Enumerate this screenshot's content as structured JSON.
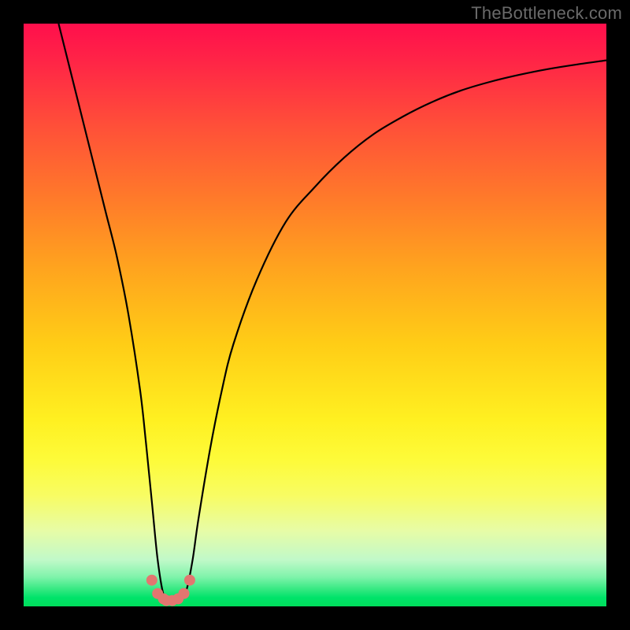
{
  "watermark": "TheBottleneck.com",
  "chart_data": {
    "type": "line",
    "title": "",
    "xlabel": "",
    "ylabel": "",
    "xlim": [
      0,
      100
    ],
    "ylim": [
      0,
      100
    ],
    "series": [
      {
        "name": "bottleneck-curve",
        "x": [
          6,
          8,
          10,
          12,
          14,
          16,
          18,
          20,
          21,
          22,
          23,
          24,
          25,
          26,
          27,
          28,
          29,
          30,
          32,
          34,
          36,
          40,
          45,
          50,
          55,
          60,
          65,
          70,
          75,
          80,
          85,
          90,
          95,
          100
        ],
        "values": [
          100,
          92,
          84,
          76,
          68,
          60,
          50,
          37,
          28,
          18,
          8,
          2,
          0.5,
          0.5,
          1,
          3,
          8,
          15,
          27,
          37,
          45,
          56,
          66,
          72,
          77,
          81,
          84,
          86.5,
          88.5,
          90,
          91.2,
          92.2,
          93,
          93.7
        ]
      }
    ],
    "markers": {
      "name": "highlight-dots",
      "x": [
        22,
        23,
        24,
        24.5,
        25.5,
        26.5,
        27.5,
        28.5
      ],
      "values": [
        4.5,
        2.2,
        1.3,
        1.0,
        1.0,
        1.3,
        2.2,
        4.5
      ],
      "radius": 7,
      "color": "#e27670"
    },
    "background_gradient": {
      "top": "#ff0f4c",
      "bottom": "#00de5b"
    }
  }
}
